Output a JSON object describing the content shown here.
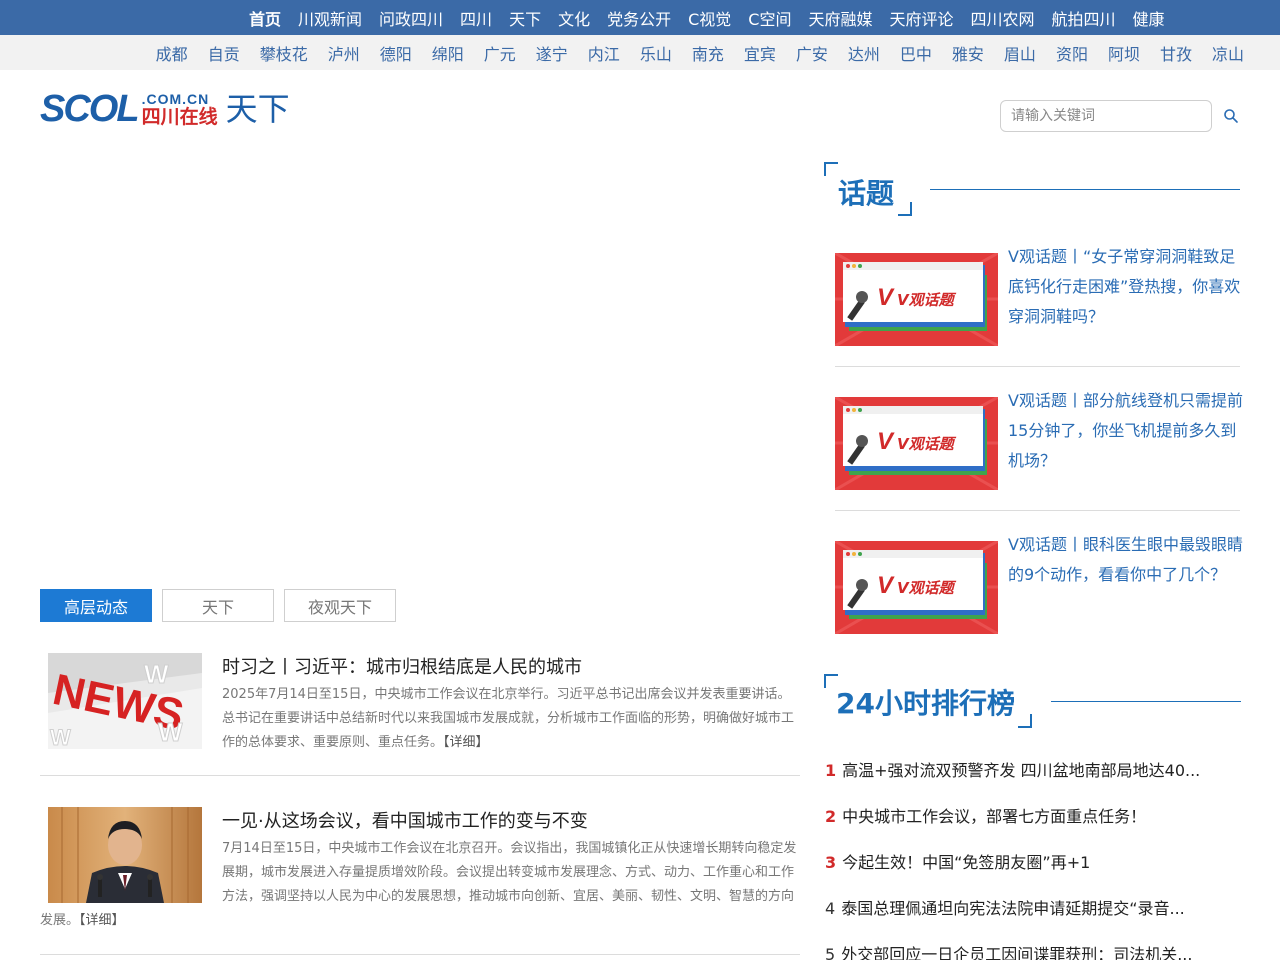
{
  "topnav": {
    "items": [
      "首页",
      "川观新闻",
      "问政四川",
      "四川",
      "天下",
      "文化",
      "党务公开",
      "C视觉",
      "C空间",
      "天府融媒",
      "天府评论",
      "四川农网",
      "航拍四川",
      "健康"
    ]
  },
  "citynav": {
    "items": [
      "成都",
      "自贡",
      "攀枝花",
      "泸州",
      "德阳",
      "绵阳",
      "广元",
      "遂宁",
      "内江",
      "乐山",
      "南充",
      "宜宾",
      "广安",
      "达州",
      "巴中",
      "雅安",
      "眉山",
      "资阳",
      "阿坝",
      "甘孜",
      "凉山"
    ]
  },
  "logo": {
    "scol": "SCOL",
    "domain": ".COM.CN",
    "site": "四川在线",
    "channel": "天下"
  },
  "search": {
    "placeholder": "请输入关键词"
  },
  "tabs": [
    "高层动态",
    "天下",
    "夜观天下"
  ],
  "news": [
    {
      "title": "时习之丨习近平：城市归根结底是人民的城市",
      "summary": "2025年7月14日至15日，中央城市工作会议在北京举行。习近平总书记出席会议并发表重要讲话。总书记在重要讲话中总结新时代以来我国城市发展成就，分析城市工作面临的形势，明确做好城市工作的总体要求、重要原则、重点任务。",
      "detail": "【详细】"
    },
    {
      "title": "一见·从这场会议，看中国城市工作的变与不变",
      "summary": "7月14日至15日，中央城市工作会议在北京召开。会议指出，我国城镇化正从快速增长期转向稳定发展期，城市发展进入存量提质增效阶段。会议提出转变城市发展理念、方式、动力、工作重心和工作方法，强调坚持以人民为中心的发展思想，推动城市向创新、宜居、美丽、韧性、文明、智慧的方向",
      "summary_tail": "发展。",
      "detail": "【详细】"
    }
  ],
  "topics_section": {
    "title": "话题",
    "items": [
      {
        "text": "V观话题丨“女子常穿洞洞鞋致足底钙化行走困难”登热搜，你喜欢穿洞洞鞋吗？",
        "image_label": "V观话题"
      },
      {
        "text": "V观话题丨部分航线登机只需提前15分钟了，你坐飞机提前多久到机场？",
        "image_label": "V观话题"
      },
      {
        "text": "V观话题丨眼科医生眼中最毁眼睛的9个动作，看看你中了几个？",
        "image_label": "V观话题"
      }
    ]
  },
  "ranking_section": {
    "title": "24小时排行榜",
    "items": [
      {
        "num": "1",
        "text": "高温+强对流双预警齐发 四川盆地南部局地达40..."
      },
      {
        "num": "2",
        "text": "中央城市工作会议，部署七方面重点任务！"
      },
      {
        "num": "3",
        "text": "今起生效！中国“免签朋友圈”再+1"
      },
      {
        "num": "4",
        "text": "泰国总理佩通坦向宪法法院申请延期提交“录音..."
      },
      {
        "num": "5",
        "text": "外交部回应一日企员工因间谍罪获刑：司法机关..."
      }
    ]
  },
  "colors": {
    "topnav_bg": "#3b6aa7",
    "citynav_bg": "#f2f2f2",
    "accent_blue": "#1d6fb8",
    "rank_red": "#d12a2a",
    "tab_active": "#1d7ad4"
  }
}
